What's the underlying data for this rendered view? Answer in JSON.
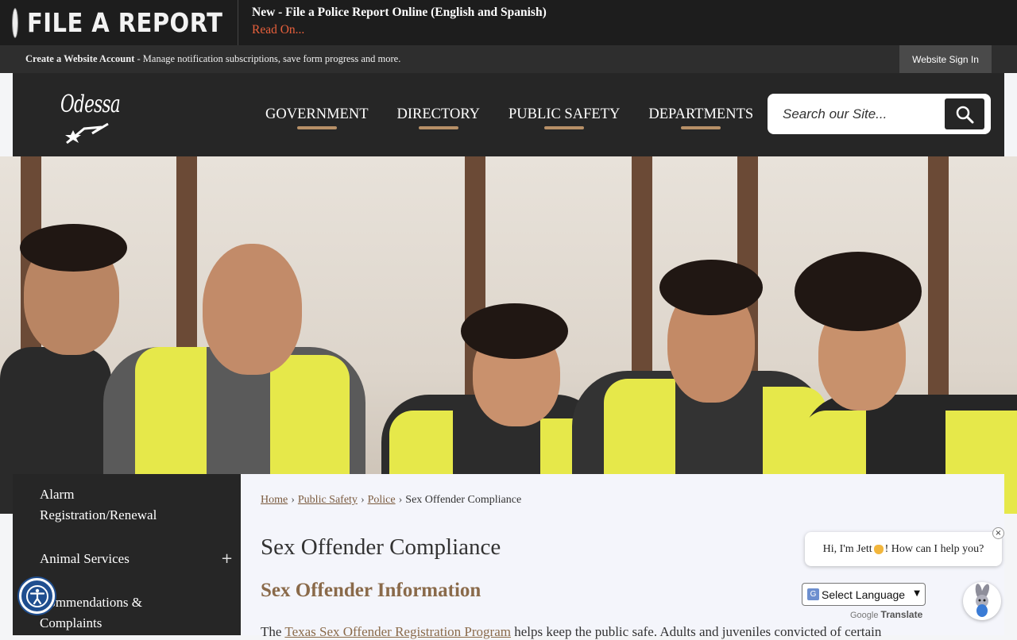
{
  "alert": {
    "title": "FILE A REPORT",
    "headline": "New - File a Police Report Online (English and Spanish)",
    "link": "Read On..."
  },
  "account_bar": {
    "create_label": "Create a Website Account",
    "create_desc": " - Manage notification subscriptions, save form progress and more.",
    "signin": "Website Sign In"
  },
  "header": {
    "logo_text": "Odessa",
    "nav": [
      "GOVERNMENT",
      "DIRECTORY",
      "PUBLIC SAFETY",
      "DEPARTMENTS"
    ],
    "search_placeholder": "Search our Site..."
  },
  "sidebar": {
    "items": [
      {
        "label_line1": "Alarm",
        "label_line2": "Registration/Renewal"
      },
      {
        "label_line1": "Animal Services",
        "plus": "+"
      },
      {
        "label_line1": "Commendations &",
        "label_line2": "Complaints"
      }
    ]
  },
  "breadcrumb": {
    "items": [
      "Home",
      "Public Safety",
      "Police"
    ],
    "current": "Sex Offender Compliance",
    "separator": "›"
  },
  "content": {
    "page_title": "Sex Offender Compliance",
    "section_title": "Sex Offender Information",
    "body_prefix": "The ",
    "body_link": "Texas Sex Offender Registration Program",
    "body_suffix": " helps keep the public safe. Adults and juveniles convicted of certain"
  },
  "chat": {
    "greeting_prefix": "Hi, I'm Jett ",
    "greeting_suffix": "! How can I help you?",
    "close": "×"
  },
  "translate": {
    "select_label": "Select Language",
    "powered_google": "Google",
    "powered_translate": "Translate"
  },
  "colors": {
    "accent_brown": "#8a6a4a",
    "nav_underline": "#b79067",
    "alert_link": "#e8603c",
    "header_bg": "#262626"
  }
}
